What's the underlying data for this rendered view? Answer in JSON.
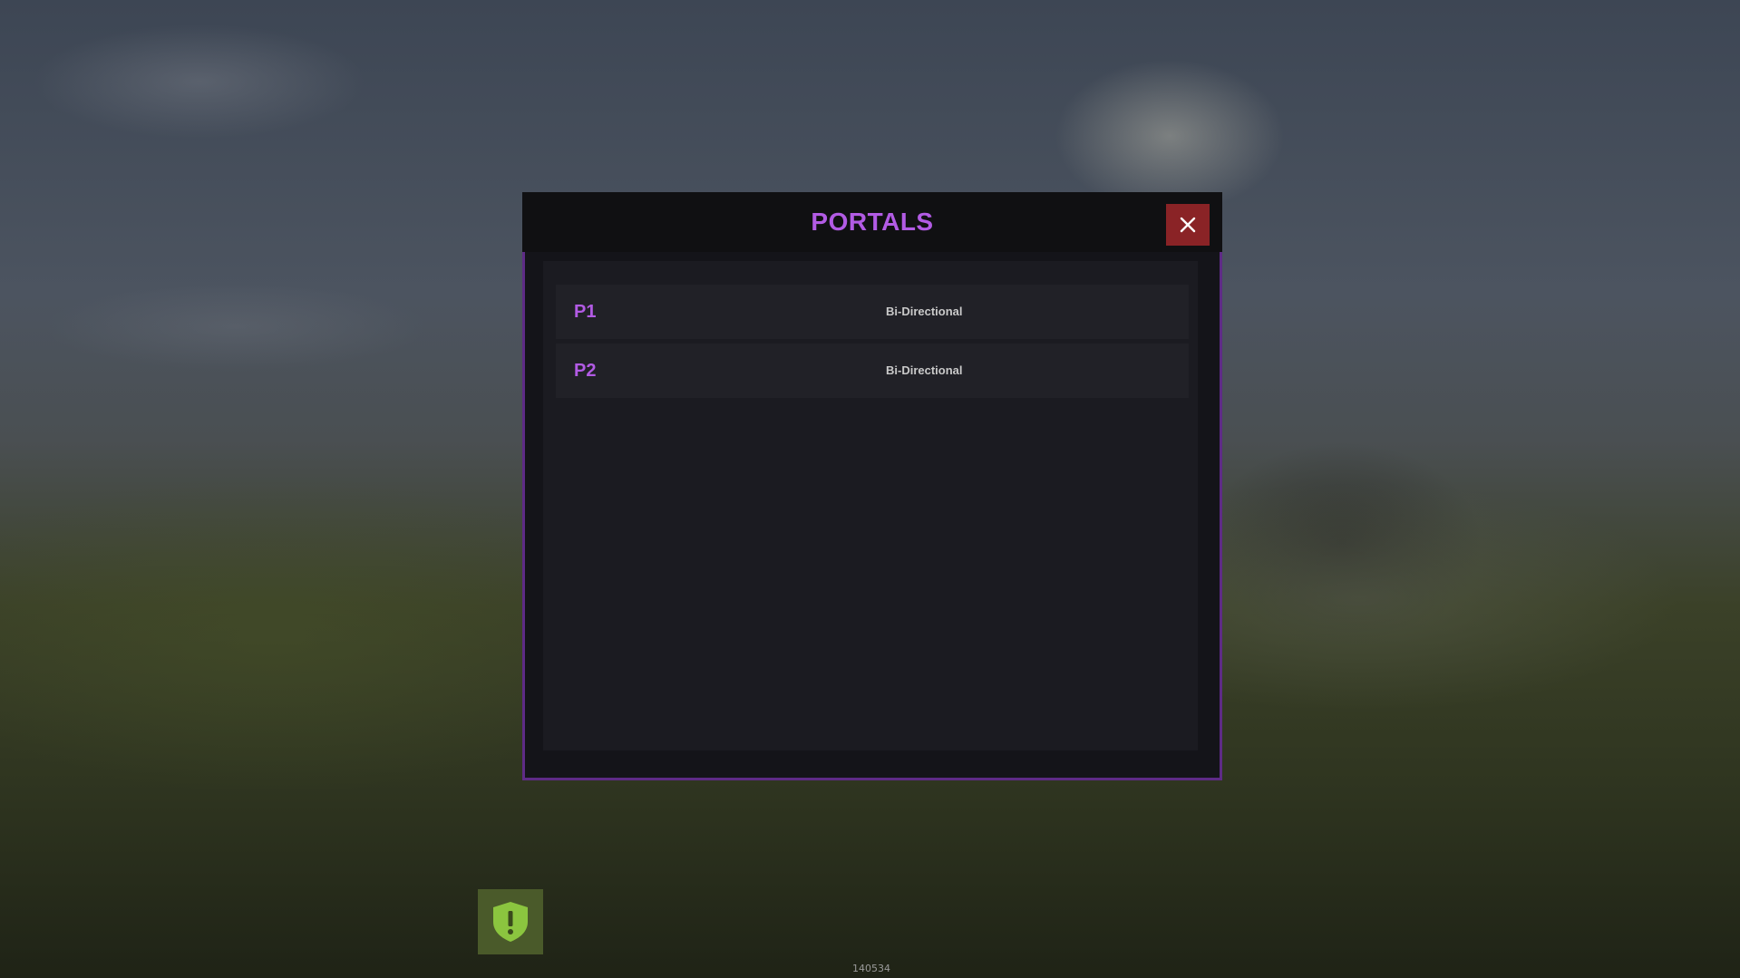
{
  "modal": {
    "title": "PORTALS",
    "close_icon": "close-icon",
    "accent_color": "#b25be4",
    "border_color": "#5e2b86",
    "close_color": "#8a2326"
  },
  "portals": [
    {
      "name": "P1",
      "mode": "Bi-Directional"
    },
    {
      "name": "P2",
      "mode": "Bi-Directional"
    }
  ],
  "hud": {
    "shield_icon": "shield-alert-icon",
    "shield_color": "#8bc53f",
    "id_text": "140534"
  }
}
